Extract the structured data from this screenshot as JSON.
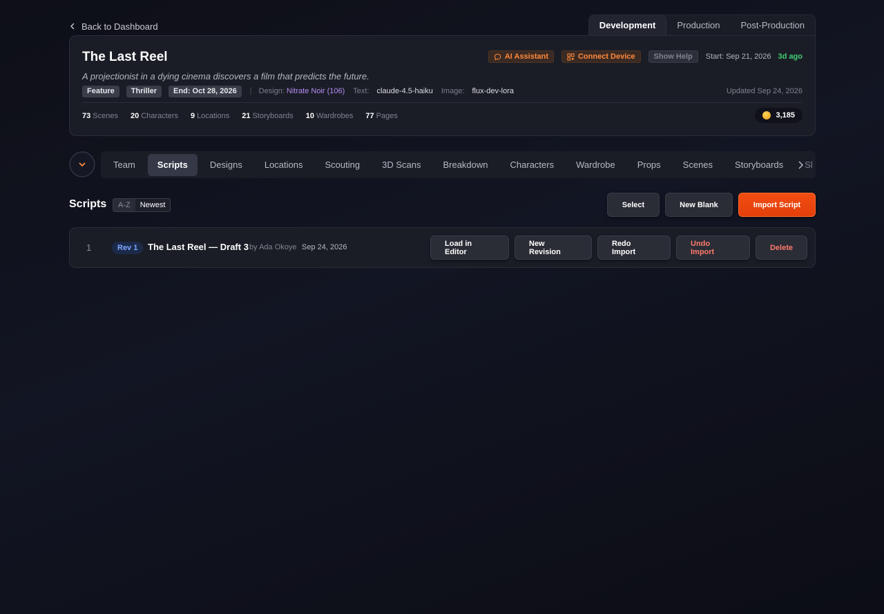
{
  "back": {
    "label": "Back to Dashboard"
  },
  "phase_tabs": [
    {
      "label": "Development",
      "active": true
    },
    {
      "label": "Production",
      "active": false
    },
    {
      "label": "Post-Production",
      "active": false
    }
  ],
  "project": {
    "title": "The Last Reel",
    "tagline": "A projectionist in a dying cinema discovers a film that predicts the future.",
    "ai_assistant": "AI Assistant",
    "connect_device": "Connect Device",
    "show_help": "Show Help",
    "start": "Start: Sep 21, 2026",
    "ago": "3d ago",
    "tags": [
      "Feature",
      "Thriller",
      "End: Oct 28, 2026"
    ],
    "design_label": "Design:",
    "design_value": "Nitrate Noir (106)",
    "text_label": "Text:",
    "text_value": "claude-4.5-haiku",
    "image_label": "Image:",
    "image_value": "flux-dev-lora",
    "updated": "Updated Sep 24, 2026",
    "stats": [
      {
        "count": "73",
        "label": "Scenes"
      },
      {
        "count": "20",
        "label": "Characters"
      },
      {
        "count": "9",
        "label": "Locations"
      },
      {
        "count": "21",
        "label": "Storyboards"
      },
      {
        "count": "10",
        "label": "Wardrobes"
      },
      {
        "count": "77",
        "label": "Pages"
      }
    ],
    "credits": "3,185"
  },
  "nav": {
    "items": [
      "Team",
      "Scripts",
      "Designs",
      "Locations",
      "Scouting",
      "3D Scans",
      "Breakdown",
      "Characters",
      "Wardrobe",
      "Props",
      "Scenes",
      "Storyboards"
    ],
    "active": "Scripts",
    "more_label": "Sl"
  },
  "scripts": {
    "title": "Scripts",
    "sort_az": "A-Z",
    "sort_newest": "Newest",
    "select": "Select",
    "new_blank": "New Blank",
    "import_script": "Import Script",
    "rows": [
      {
        "num": "1",
        "rev": "Rev 1",
        "title": "The Last Reel — Draft 3",
        "by": "by Ada Okoye",
        "date": "Sep 24, 2026",
        "load": "Load in Editor",
        "new_revision": "New Revision",
        "redo_import": "Redo Import",
        "undo_import": "Undo Import",
        "delete": "Delete"
      }
    ]
  },
  "colors": {
    "accent": "#e8450e",
    "link_purple": "#b48cf5",
    "success": "#3fcf74",
    "danger": "#ff7a6a"
  }
}
